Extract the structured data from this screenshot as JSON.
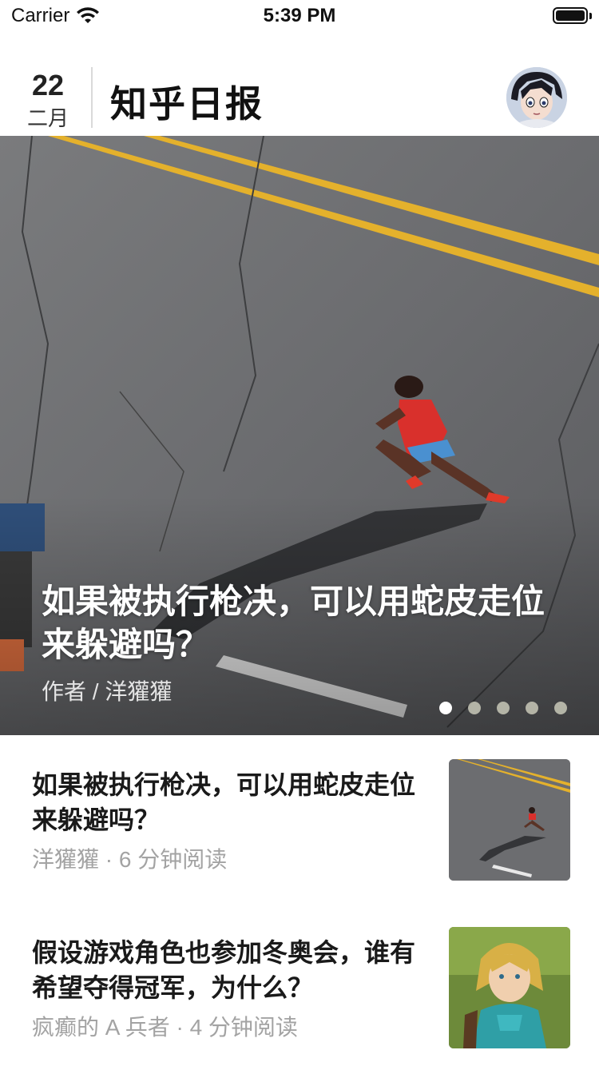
{
  "status_bar": {
    "carrier": "Carrier",
    "time": "5:39 PM"
  },
  "header": {
    "day": "22",
    "month": "二月",
    "title": "知乎日报"
  },
  "hero": {
    "title": "如果被执行枪决，可以用蛇皮走位来躲避吗？",
    "author": "作者 / 洋獾獾",
    "page_count": 5,
    "active_page": 1
  },
  "stories": [
    {
      "title": "如果被执行枪决，可以用蛇皮走位来躲避吗？",
      "meta": "洋獾獾 · 6 分钟阅读",
      "thumbnail": "runner-aerial-photo"
    },
    {
      "title": "假设游戏角色也参加冬奥会，谁有希望夺得冠军，为什么？",
      "meta": "疯癫的 A 兵者 · 4 分钟阅读",
      "thumbnail": "game-character-portrait"
    }
  ],
  "icons": {
    "wifi": "wifi-icon",
    "battery": "battery-icon",
    "avatar": "user-avatar"
  },
  "colors": {
    "road": "#6a6b6d",
    "road_line": "#e6b22e",
    "meta_text": "#a3a3a3"
  }
}
